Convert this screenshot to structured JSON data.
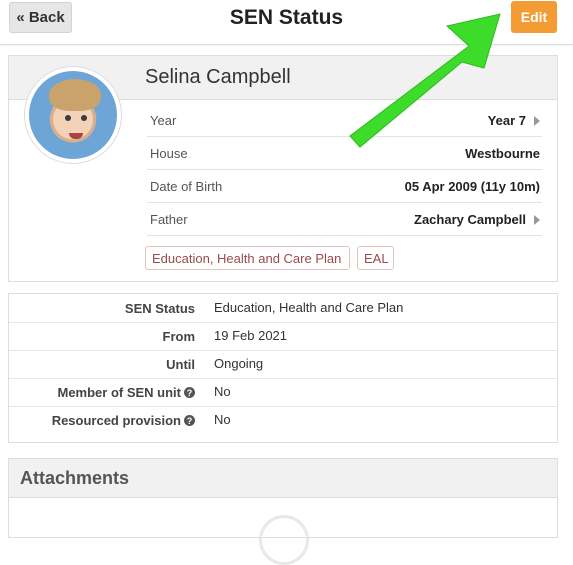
{
  "header": {
    "back_label": "« Back",
    "title": "SEN Status",
    "edit_label": "Edit"
  },
  "profile": {
    "name": "Selina Campbell",
    "rows": [
      {
        "label": "Year",
        "value": "Year 7",
        "chevron": true
      },
      {
        "label": "House",
        "value": "Westbourne",
        "chevron": false
      },
      {
        "label": "Date of Birth",
        "value": "05 Apr 2009 (11y 10m)",
        "chevron": false
      },
      {
        "label": "Father",
        "value": "Zachary Campbell",
        "chevron": true
      }
    ],
    "tags": [
      "Education, Health and Care Plan",
      "EAL"
    ]
  },
  "sen": {
    "rows": [
      {
        "label": "SEN Status",
        "value": "Education, Health and Care Plan",
        "help": false
      },
      {
        "label": "From",
        "value": "19 Feb 2021",
        "help": false
      },
      {
        "label": "Until",
        "value": "Ongoing",
        "help": false
      },
      {
        "label": "Member of SEN unit",
        "value": "No",
        "help": true
      },
      {
        "label": "Resourced provision",
        "value": "No",
        "help": true
      }
    ]
  },
  "attachments": {
    "title": "Attachments"
  },
  "colors": {
    "accent": "#f39c33",
    "annotation_arrow": "#3ddc2a",
    "tag_text": "#9b4a4a"
  },
  "icons": {
    "help": "help-circle-icon",
    "chevron": "chevron-right-icon"
  }
}
